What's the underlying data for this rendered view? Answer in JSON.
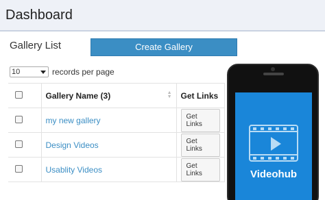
{
  "header": {
    "title": "Dashboard"
  },
  "gallery": {
    "section_title": "Gallery List",
    "create_button": "Create Gallery",
    "page_size": "10",
    "records_label": "records per page",
    "columns": {
      "name": "Gallery Name (3)",
      "links": "Get Links"
    },
    "rows": [
      {
        "name": "my new gallery",
        "action": "Get Links"
      },
      {
        "name": "Design Videos",
        "action": "Get Links"
      },
      {
        "name": "Usablity Videos",
        "action": "Get Links"
      }
    ]
  },
  "promo": {
    "brand": "Videohub"
  },
  "colors": {
    "accent": "#3b8ec4",
    "screen": "#1a86d9",
    "header_bg": "#eef1f7"
  }
}
